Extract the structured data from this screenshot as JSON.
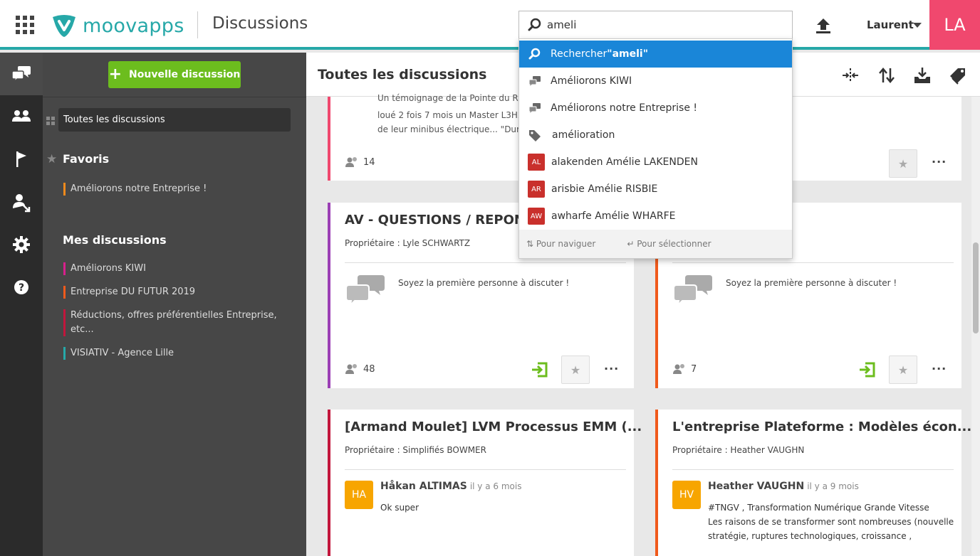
{
  "header": {
    "brand": "moovapps",
    "app_title": "Discussions",
    "search_value": "ameli",
    "user_name": "Laurent",
    "user_initials": "LA",
    "accent_color": "#26a8a8",
    "avatar_color": "#f0486e"
  },
  "rail": {
    "items": [
      "discussions-icon",
      "users-icon",
      "flag-icon",
      "user-arrow-icon",
      "gear-icon",
      "help-icon"
    ]
  },
  "sidebar": {
    "new_button_label": "Nouvelle discussion",
    "all_discussions": "Toutes les discussions",
    "favorites_heading": "Favoris",
    "favorites": [
      {
        "label": "Améliorons notre Entreprise !",
        "color": "#f08a1c"
      }
    ],
    "my_heading": "Mes discussions",
    "my_discussions": [
      {
        "label": "Améliorons KIWI",
        "color": "#d8208c"
      },
      {
        "label": "Entreprise DU FUTUR 2019",
        "color": "#f05a1c"
      },
      {
        "label": "Réductions, offres préférentielles Entreprise, etc...",
        "color": "#c2163c"
      },
      {
        "label": "VISIATIV - Agence Lille",
        "color": "#26a8a8"
      }
    ]
  },
  "main": {
    "title": "Toutes les discussions",
    "top_card": {
      "text_lines": [
        "Un témoignage de la Pointe du Raz",
        "loué 2 fois 7 mois un Master L3H2 f",
        "de leur minibus électrique... \"Dura"
      ],
      "count": "14",
      "color": "#f0486e"
    },
    "cards": [
      {
        "title": "AV - QUESTIONS / REPONSES",
        "owner": "Propriétaire : Lyle SCHWARTZ",
        "empty": "Soyez la première personne à discuter !",
        "count": "48",
        "color": "#9b3fb5"
      },
      {
        "title": "",
        "owner": "",
        "empty": "Soyez la première personne à discuter !",
        "count": "7",
        "color": "#f05a1c"
      },
      {
        "title": "[Armand Moulet] LVM Processus EMM (...",
        "owner": "Propriétaire : Simplifiés BOWMER",
        "author": "Håkan ALTIMAS",
        "initials": "HA",
        "time": "il y a 6 mois",
        "text": "Ok super",
        "color": "#c2163c"
      },
      {
        "title": "L'entreprise Plateforme : Modèles écon...",
        "owner": "Propriétaire : Heather VAUGHN",
        "author": "Heather VAUGHN",
        "initials": "HV",
        "time": "il y a 9 mois",
        "text_lines": [
          "#TNGV , Transformation Numérique Grande Vitesse",
          "Les raisons de se transformer sont nombreuses (nouvelle",
          "stratégie, ruptures technologiques, croissance ,"
        ],
        "color": "#f05a1c"
      }
    ],
    "more_label": "···"
  },
  "dropdown": {
    "search_prefix": "Rechercher ",
    "search_term": "\"ameli\"",
    "items": [
      {
        "type": "discussion",
        "label": "Améliorons KIWI"
      },
      {
        "type": "discussion",
        "label": "Améliorons notre Entreprise !"
      },
      {
        "type": "tag",
        "label": "amélioration"
      },
      {
        "type": "user",
        "initials": "AL",
        "label": "alakenden Amélie LAKENDEN"
      },
      {
        "type": "user",
        "initials": "AR",
        "label": "arisbie Amélie RISBIE"
      },
      {
        "type": "user",
        "initials": "AW",
        "label": "awharfe Amélie WHARFE"
      }
    ],
    "hint_navigate": "Pour naviguer",
    "hint_select": "Pour sélectionner"
  }
}
